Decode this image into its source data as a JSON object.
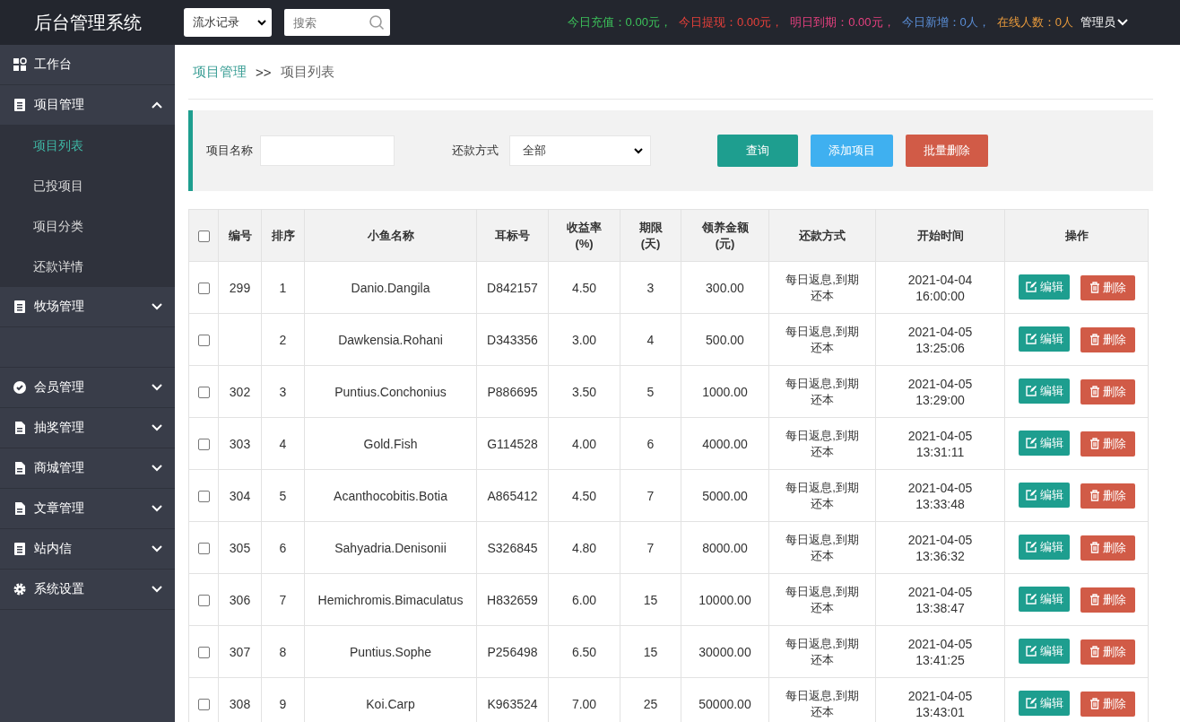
{
  "header": {
    "title": "后台管理系统",
    "dropdown": "流水记录",
    "search": {
      "placeholder": "搜索"
    },
    "stats": [
      {
        "text": "今日充值：0.00元，",
        "color": "#3cc15a"
      },
      {
        "text": "今日提现：0.00元，",
        "color": "#e8403a"
      },
      {
        "text": "明日到期：0.00元，",
        "color": "#e5407f"
      },
      {
        "text": "今日新增：0人，",
        "color": "#5b8fd8"
      },
      {
        "text": "在线人数：0人",
        "color": "#e89a3c"
      }
    ],
    "user": "管理员"
  },
  "sidebar": {
    "items": [
      {
        "kind": "link",
        "label": "工作台"
      },
      {
        "kind": "group",
        "label": "项目管理",
        "expanded": true,
        "children": [
          {
            "label": "项目列表",
            "selected": true
          },
          {
            "label": "已投项目",
            "selected": false
          },
          {
            "label": "项目分类",
            "selected": false
          },
          {
            "label": "还款详情",
            "selected": false
          }
        ]
      },
      {
        "kind": "group",
        "label": "牧场管理",
        "expanded": false
      },
      {
        "kind": "hidden"
      },
      {
        "kind": "group",
        "label": "会员管理",
        "expanded": false
      },
      {
        "kind": "group",
        "label": "抽奖管理",
        "expanded": false
      },
      {
        "kind": "group",
        "label": "商城管理",
        "expanded": false
      },
      {
        "kind": "group",
        "label": "文章管理",
        "expanded": false
      },
      {
        "kind": "group",
        "label": "站内信",
        "expanded": false
      },
      {
        "kind": "group",
        "label": "系统设置",
        "expanded": false
      }
    ]
  },
  "breadcrumb": [
    "项目管理",
    ">>",
    "项目列表"
  ],
  "filter": {
    "name_label": "项目名称",
    "method_label": "还款方式",
    "method_value": "全部",
    "buttons": [
      {
        "label": "查询",
        "kind": "query"
      },
      {
        "label": "添加项目",
        "kind": "add"
      },
      {
        "label": "批量删除",
        "kind": "delete"
      }
    ]
  },
  "table": {
    "select_all_checked": false,
    "columns": [
      "编号",
      "排序",
      "小鱼名称",
      "耳标号",
      "收益率\n(%)",
      "期限\n(天)",
      "领养金额\n(元)",
      "还款方式",
      "开始时间",
      "操作"
    ],
    "rows": [
      {
        "checked": false,
        "id": "299",
        "order": "1",
        "name": "Danio.Dangila",
        "tag": "D842157",
        "rate": "4.50",
        "term": "3",
        "amount": "300.00",
        "method": "每日返息,到期还本",
        "start": "2021-04-04 16:00:00",
        "actions": [
          "编辑",
          "删除"
        ]
      },
      {
        "checked": false,
        "order": "2",
        "name": "Dawkensia.Rohani",
        "tag": "D343356",
        "rate": "3.00",
        "term": "4",
        "amount": "500.00",
        "method": "每日返息,到期还本",
        "start": "2021-04-05 13:25:06",
        "actions": [
          "编辑",
          "删除"
        ]
      },
      {
        "checked": false,
        "id": "302",
        "order": "3",
        "name": "Puntius.Conchonius",
        "tag": "P886695",
        "rate": "3.50",
        "term": "5",
        "amount": "1000.00",
        "method": "每日返息,到期还本",
        "start": "2021-04-05 13:29:00",
        "actions": [
          "编辑",
          "删除"
        ]
      },
      {
        "checked": false,
        "id": "303",
        "order": "4",
        "name": "Gold.Fish",
        "tag": "G114528",
        "rate": "4.00",
        "term": "6",
        "amount": "4000.00",
        "method": "每日返息,到期还本",
        "start": "2021-04-05 13:31:11",
        "actions": [
          "编辑",
          "删除"
        ]
      },
      {
        "checked": false,
        "id": "304",
        "order": "5",
        "name": "Acanthocobitis.Botia",
        "tag": "A865412",
        "rate": "4.50",
        "term": "7",
        "amount": "5000.00",
        "method": "每日返息,到期还本",
        "start": "2021-04-05 13:33:48",
        "actions": [
          "编辑",
          "删除"
        ]
      },
      {
        "checked": false,
        "id": "305",
        "order": "6",
        "name": "Sahyadria.Denisonii",
        "tag": "S326845",
        "rate": "4.80",
        "term": "7",
        "amount": "8000.00",
        "method": "每日返息,到期还本",
        "start": "2021-04-05 13:36:32",
        "actions": [
          "编辑",
          "删除"
        ]
      },
      {
        "checked": false,
        "id": "306",
        "order": "7",
        "name": "Hemichromis.Bimaculatus",
        "tag": "H832659",
        "rate": "6.00",
        "term": "15",
        "amount": "10000.00",
        "method": "每日返息,到期还本",
        "start": "2021-04-05 13:38:47",
        "actions": [
          "编辑",
          "删除"
        ]
      },
      {
        "checked": false,
        "id": "307",
        "order": "8",
        "name": "Puntius.Sophe",
        "tag": "P256498",
        "rate": "6.50",
        "term": "15",
        "amount": "30000.00",
        "method": "每日返息,到期还本",
        "start": "2021-04-05 13:41:25",
        "actions": [
          "编辑",
          "删除"
        ]
      },
      {
        "checked": false,
        "id": "308",
        "order": "9",
        "name": "Koi.Carp",
        "tag": "K963524",
        "rate": "7.00",
        "term": "25",
        "amount": "50000.00",
        "method": "每日返息,到期还本",
        "start": "2021-04-05 13:43:01",
        "actions": [
          "编辑",
          "删除"
        ]
      }
    ]
  }
}
